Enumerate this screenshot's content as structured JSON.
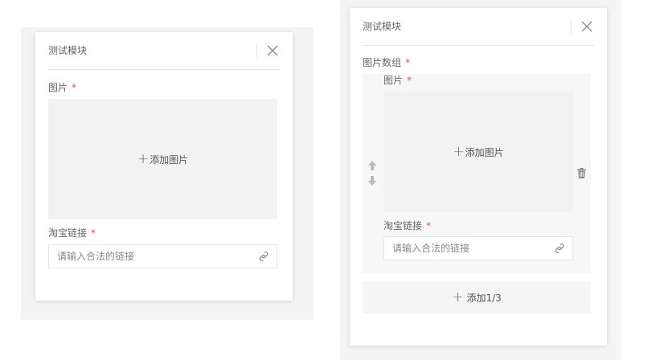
{
  "left_panel": {
    "title": "测试模块",
    "image_label": "图片",
    "required_mark": "*",
    "add_image": "添加图片",
    "link_label": "淘宝链接",
    "link_placeholder": "请输入合法的链接"
  },
  "right_panel": {
    "title": "测试模块",
    "array_label": "图片数组",
    "required_mark": "*",
    "item": {
      "image_label": "图片",
      "add_image": "添加图片",
      "link_label": "淘宝链接",
      "link_placeholder": "请输入合法的链接"
    },
    "add_button": "添加1/3"
  },
  "colors": {
    "required": "#e05555",
    "image_placeholder_bg": "#f2f2f2",
    "page_bg": "#f4f4f4"
  },
  "icons": {
    "close": "close-icon",
    "link": "link-icon",
    "move_up": "arrow-up-icon",
    "move_down": "arrow-down-icon",
    "delete": "trash-icon",
    "plus": "plus-icon"
  }
}
